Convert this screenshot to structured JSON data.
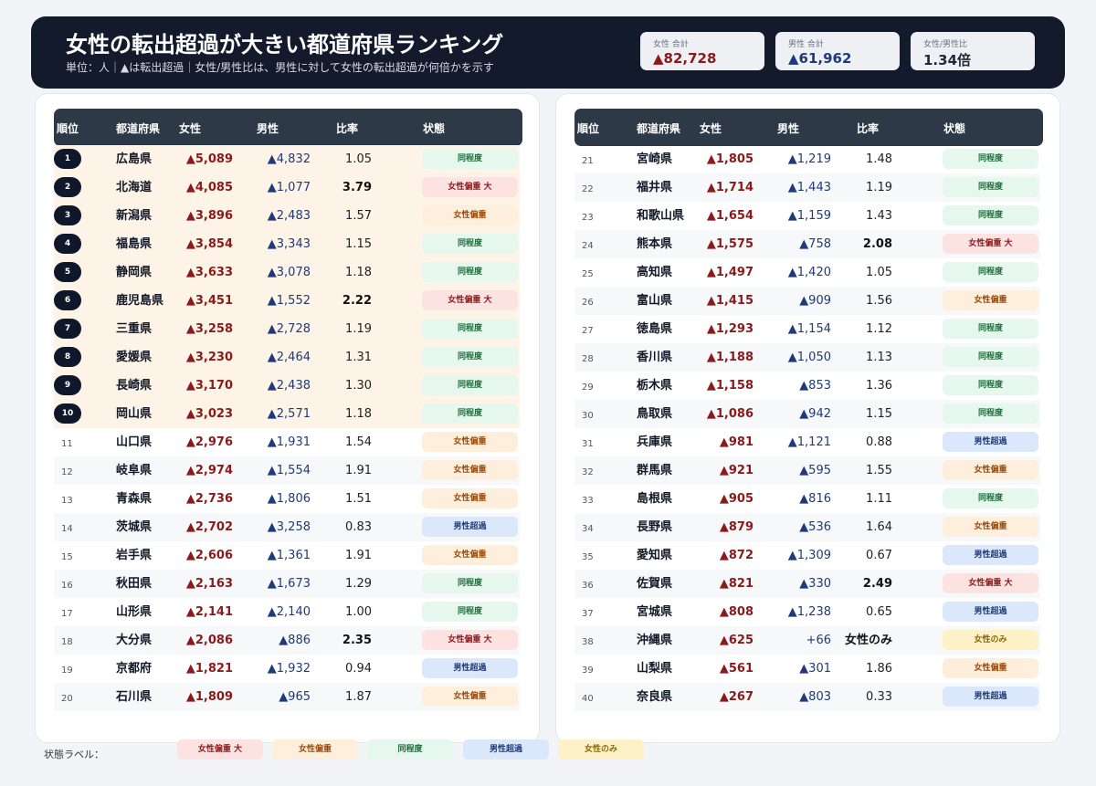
{
  "header": {
    "title": "女性の転出超過が大きい都道府県ランキング",
    "subtitle": "単位：人｜▲は転出超過｜女性/男性比は、男性に対して女性の転出超過が何倍かを示す"
  },
  "stats": [
    {
      "label": "女性 合計",
      "value": "▲82,728",
      "color": "#8b1a1a"
    },
    {
      "label": "男性 合計",
      "value": "▲61,962",
      "color": "#1e3a7b"
    },
    {
      "label": "女性/男性比",
      "value": "1.34倍",
      "color": "#1f2937"
    }
  ],
  "table_headers": {
    "rank": "順位",
    "prefecture": "都道府県",
    "female": "女性",
    "male": "男性",
    "ratio": "比率",
    "status": "状態"
  },
  "legend": {
    "label": "状態ラベル：",
    "items": [
      {
        "label": "女性偏重 大",
        "key": "big"
      },
      {
        "label": "女性偏重",
        "key": "female"
      },
      {
        "label": "同程度",
        "key": "same"
      },
      {
        "label": "男性超過",
        "key": "male"
      },
      {
        "label": "女性のみ",
        "key": "only"
      }
    ]
  },
  "colors": {
    "header_bg": "#121a2c",
    "female_text": "#8b1a1a",
    "male_text": "#1e3a7b",
    "table_header_bg": "#2e3948",
    "top10_row_bg": "#fdf3e6"
  },
  "chart_data": {
    "type": "table",
    "title": "女性の転出超過が大きい都道府県ランキング",
    "columns": [
      "順位",
      "都道府県",
      "女性",
      "男性",
      "比率",
      "状態"
    ],
    "rows": [
      {
        "rank": "1",
        "pref": "広島県",
        "female": "▲5,089",
        "male": "▲4,832",
        "ratio": "1.05",
        "status": "同程度",
        "key": "same"
      },
      {
        "rank": "2",
        "pref": "北海道",
        "female": "▲4,085",
        "male": "▲1,077",
        "ratio": "3.79",
        "status": "女性偏重 大",
        "key": "big"
      },
      {
        "rank": "3",
        "pref": "新潟県",
        "female": "▲3,896",
        "male": "▲2,483",
        "ratio": "1.57",
        "status": "女性偏重",
        "key": "female"
      },
      {
        "rank": "4",
        "pref": "福島県",
        "female": "▲3,854",
        "male": "▲3,343",
        "ratio": "1.15",
        "status": "同程度",
        "key": "same"
      },
      {
        "rank": "5",
        "pref": "静岡県",
        "female": "▲3,633",
        "male": "▲3,078",
        "ratio": "1.18",
        "status": "同程度",
        "key": "same"
      },
      {
        "rank": "6",
        "pref": "鹿児島県",
        "female": "▲3,451",
        "male": "▲1,552",
        "ratio": "2.22",
        "status": "女性偏重 大",
        "key": "big"
      },
      {
        "rank": "7",
        "pref": "三重県",
        "female": "▲3,258",
        "male": "▲2,728",
        "ratio": "1.19",
        "status": "同程度",
        "key": "same"
      },
      {
        "rank": "8",
        "pref": "愛媛県",
        "female": "▲3,230",
        "male": "▲2,464",
        "ratio": "1.31",
        "status": "同程度",
        "key": "same"
      },
      {
        "rank": "9",
        "pref": "長崎県",
        "female": "▲3,170",
        "male": "▲2,438",
        "ratio": "1.30",
        "status": "同程度",
        "key": "same"
      },
      {
        "rank": "10",
        "pref": "岡山県",
        "female": "▲3,023",
        "male": "▲2,571",
        "ratio": "1.18",
        "status": "同程度",
        "key": "same"
      },
      {
        "rank": "11",
        "pref": "山口県",
        "female": "▲2,976",
        "male": "▲1,931",
        "ratio": "1.54",
        "status": "女性偏重",
        "key": "female"
      },
      {
        "rank": "12",
        "pref": "岐阜県",
        "female": "▲2,974",
        "male": "▲1,554",
        "ratio": "1.91",
        "status": "女性偏重",
        "key": "female"
      },
      {
        "rank": "13",
        "pref": "青森県",
        "female": "▲2,736",
        "male": "▲1,806",
        "ratio": "1.51",
        "status": "女性偏重",
        "key": "female"
      },
      {
        "rank": "14",
        "pref": "茨城県",
        "female": "▲2,702",
        "male": "▲3,258",
        "ratio": "0.83",
        "status": "男性超過",
        "key": "male"
      },
      {
        "rank": "15",
        "pref": "岩手県",
        "female": "▲2,606",
        "male": "▲1,361",
        "ratio": "1.91",
        "status": "女性偏重",
        "key": "female"
      },
      {
        "rank": "16",
        "pref": "秋田県",
        "female": "▲2,163",
        "male": "▲1,673",
        "ratio": "1.29",
        "status": "同程度",
        "key": "same"
      },
      {
        "rank": "17",
        "pref": "山形県",
        "female": "▲2,141",
        "male": "▲2,140",
        "ratio": "1.00",
        "status": "同程度",
        "key": "same"
      },
      {
        "rank": "18",
        "pref": "大分県",
        "female": "▲2,086",
        "male": "▲886",
        "ratio": "2.35",
        "status": "女性偏重 大",
        "key": "big"
      },
      {
        "rank": "19",
        "pref": "京都府",
        "female": "▲1,821",
        "male": "▲1,932",
        "ratio": "0.94",
        "status": "男性超過",
        "key": "male"
      },
      {
        "rank": "20",
        "pref": "石川県",
        "female": "▲1,809",
        "male": "▲965",
        "ratio": "1.87",
        "status": "女性偏重",
        "key": "female"
      },
      {
        "rank": "21",
        "pref": "宮崎県",
        "female": "▲1,805",
        "male": "▲1,219",
        "ratio": "1.48",
        "status": "同程度",
        "key": "same"
      },
      {
        "rank": "22",
        "pref": "福井県",
        "female": "▲1,714",
        "male": "▲1,443",
        "ratio": "1.19",
        "status": "同程度",
        "key": "same"
      },
      {
        "rank": "23",
        "pref": "和歌山県",
        "female": "▲1,654",
        "male": "▲1,159",
        "ratio": "1.43",
        "status": "同程度",
        "key": "same"
      },
      {
        "rank": "24",
        "pref": "熊本県",
        "female": "▲1,575",
        "male": "▲758",
        "ratio": "2.08",
        "status": "女性偏重 大",
        "key": "big"
      },
      {
        "rank": "25",
        "pref": "高知県",
        "female": "▲1,497",
        "male": "▲1,420",
        "ratio": "1.05",
        "status": "同程度",
        "key": "same"
      },
      {
        "rank": "26",
        "pref": "富山県",
        "female": "▲1,415",
        "male": "▲909",
        "ratio": "1.56",
        "status": "女性偏重",
        "key": "female"
      },
      {
        "rank": "27",
        "pref": "徳島県",
        "female": "▲1,293",
        "male": "▲1,154",
        "ratio": "1.12",
        "status": "同程度",
        "key": "same"
      },
      {
        "rank": "28",
        "pref": "香川県",
        "female": "▲1,188",
        "male": "▲1,050",
        "ratio": "1.13",
        "status": "同程度",
        "key": "same"
      },
      {
        "rank": "29",
        "pref": "栃木県",
        "female": "▲1,158",
        "male": "▲853",
        "ratio": "1.36",
        "status": "同程度",
        "key": "same"
      },
      {
        "rank": "30",
        "pref": "鳥取県",
        "female": "▲1,086",
        "male": "▲942",
        "ratio": "1.15",
        "status": "同程度",
        "key": "same"
      },
      {
        "rank": "31",
        "pref": "兵庫県",
        "female": "▲981",
        "male": "▲1,121",
        "ratio": "0.88",
        "status": "男性超過",
        "key": "male"
      },
      {
        "rank": "32",
        "pref": "群馬県",
        "female": "▲921",
        "male": "▲595",
        "ratio": "1.55",
        "status": "女性偏重",
        "key": "female"
      },
      {
        "rank": "33",
        "pref": "島根県",
        "female": "▲905",
        "male": "▲816",
        "ratio": "1.11",
        "status": "同程度",
        "key": "same"
      },
      {
        "rank": "34",
        "pref": "長野県",
        "female": "▲879",
        "male": "▲536",
        "ratio": "1.64",
        "status": "女性偏重",
        "key": "female"
      },
      {
        "rank": "35",
        "pref": "愛知県",
        "female": "▲872",
        "male": "▲1,309",
        "ratio": "0.67",
        "status": "男性超過",
        "key": "male"
      },
      {
        "rank": "36",
        "pref": "佐賀県",
        "female": "▲821",
        "male": "▲330",
        "ratio": "2.49",
        "status": "女性偏重 大",
        "key": "big"
      },
      {
        "rank": "37",
        "pref": "宮城県",
        "female": "▲808",
        "male": "▲1,238",
        "ratio": "0.65",
        "status": "男性超過",
        "key": "male"
      },
      {
        "rank": "38",
        "pref": "沖縄県",
        "female": "▲625",
        "male": "+66",
        "ratio": "女性のみ",
        "status": "女性のみ",
        "key": "only"
      },
      {
        "rank": "39",
        "pref": "山梨県",
        "female": "▲561",
        "male": "▲301",
        "ratio": "1.86",
        "status": "女性偏重",
        "key": "female"
      },
      {
        "rank": "40",
        "pref": "奈良県",
        "female": "▲267",
        "male": "▲803",
        "ratio": "0.33",
        "status": "男性超過",
        "key": "male"
      }
    ]
  }
}
